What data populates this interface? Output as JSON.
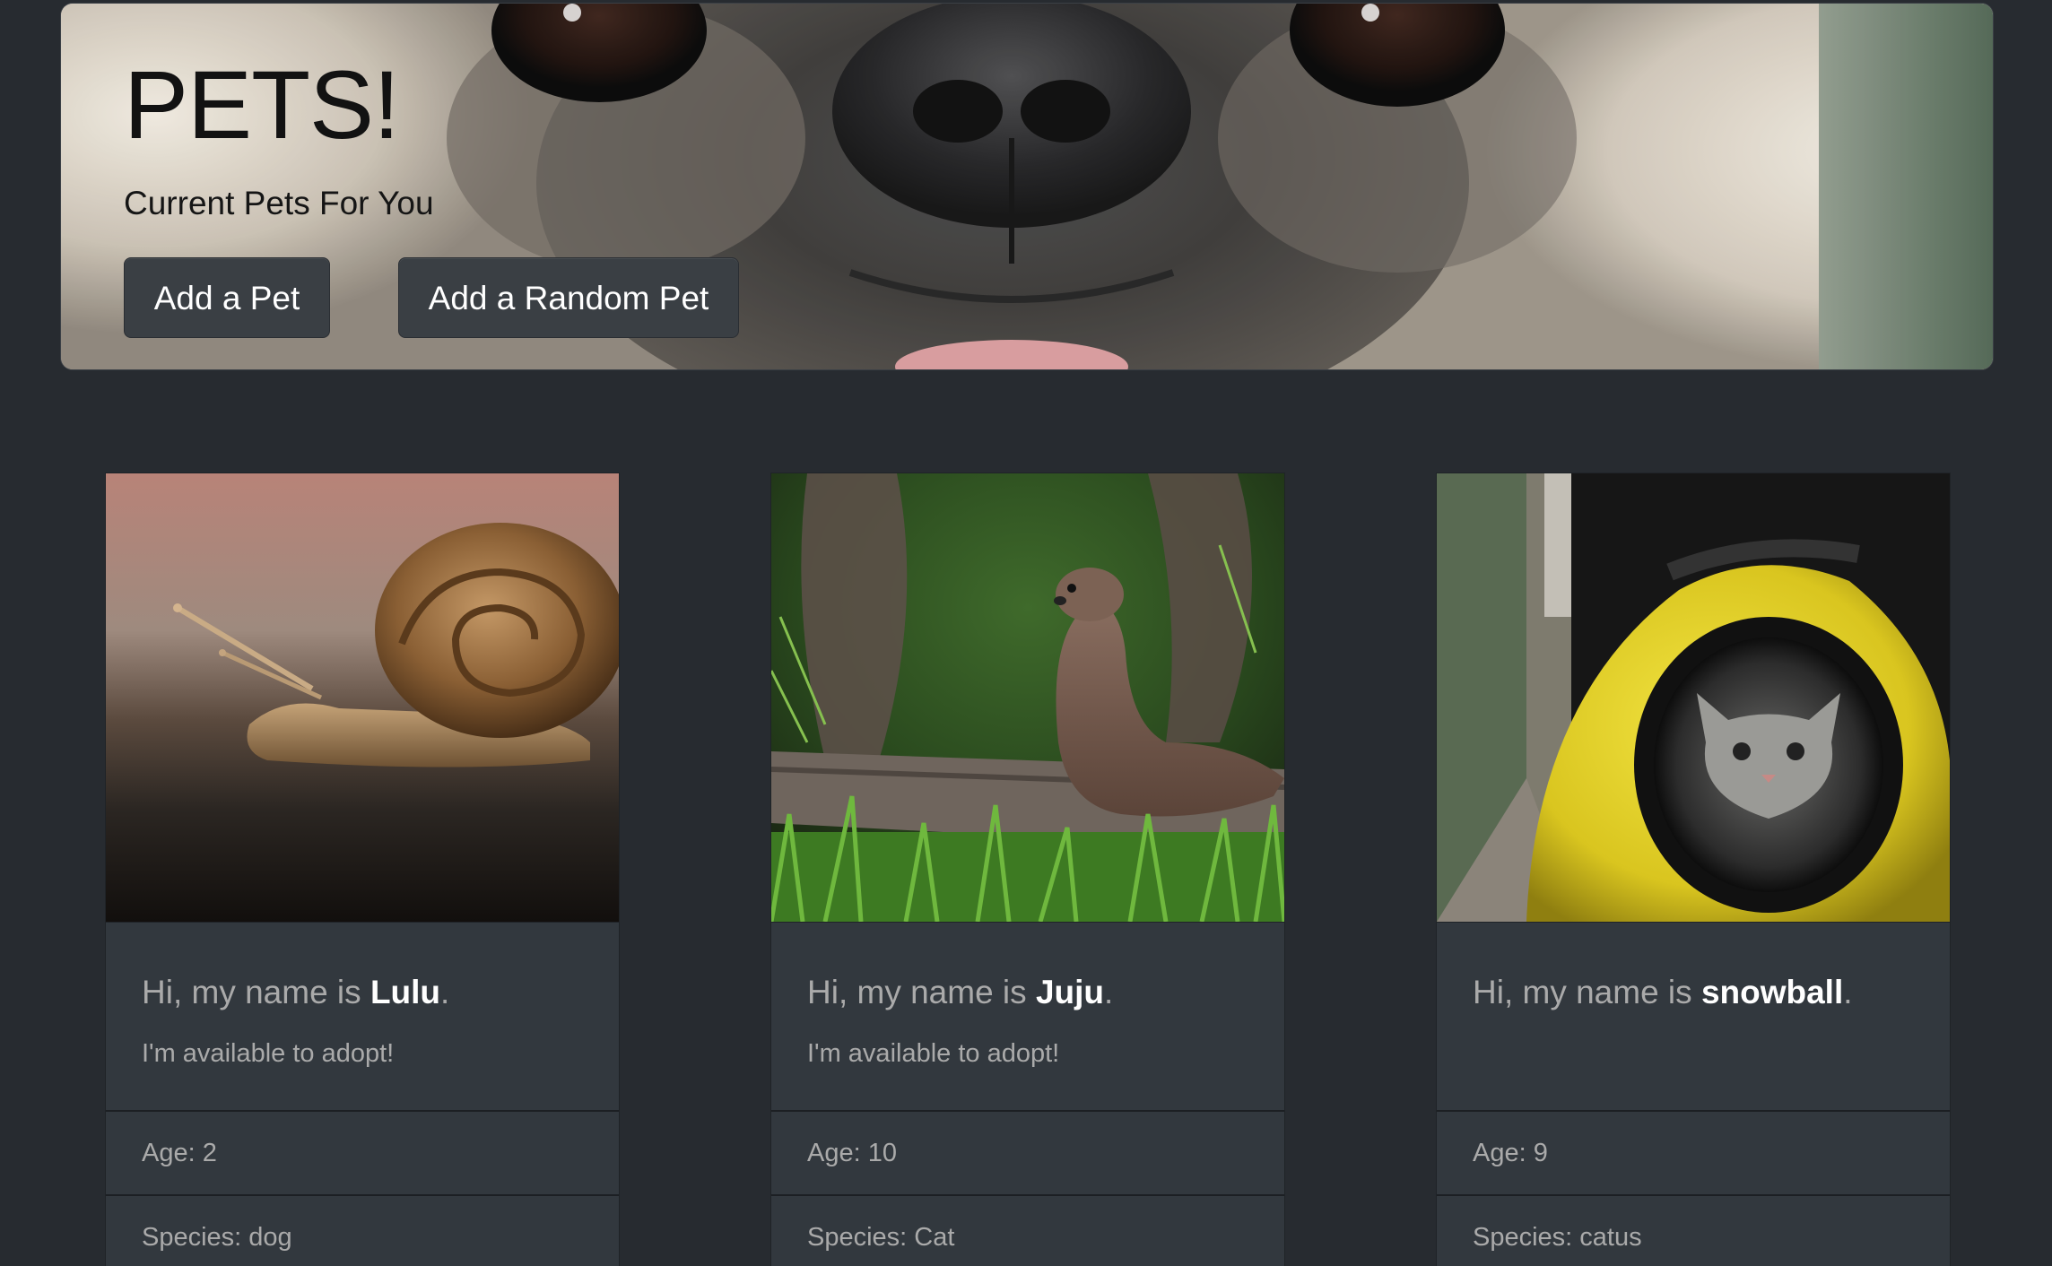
{
  "header": {
    "title": "PETS!",
    "subtitle": "Current Pets For You",
    "buttons": {
      "add_pet": "Add a Pet",
      "add_random_pet": "Add a Random Pet"
    }
  },
  "pets": [
    {
      "greeting": "Hi, my name is ",
      "name": "Lulu",
      "punct": ".",
      "status": "I'm available to adopt!",
      "age": "Age: 2",
      "species": "Species: dog"
    },
    {
      "greeting": "Hi, my name is ",
      "name": "Juju",
      "punct": ".",
      "status": "I'm available to adopt!",
      "age": "Age: 10",
      "species": "Species: Cat"
    },
    {
      "greeting": "Hi, my name is ",
      "name": "snowball",
      "punct": ".",
      "status": "",
      "age": "Age: 9",
      "species": "Species: catus"
    }
  ],
  "colors": {
    "page_bg": "#272b30",
    "card_bg": "#32383e",
    "button_bg": "#3a3f44",
    "muted_text": "#aaaaaa",
    "name_text": "#ffffff"
  }
}
